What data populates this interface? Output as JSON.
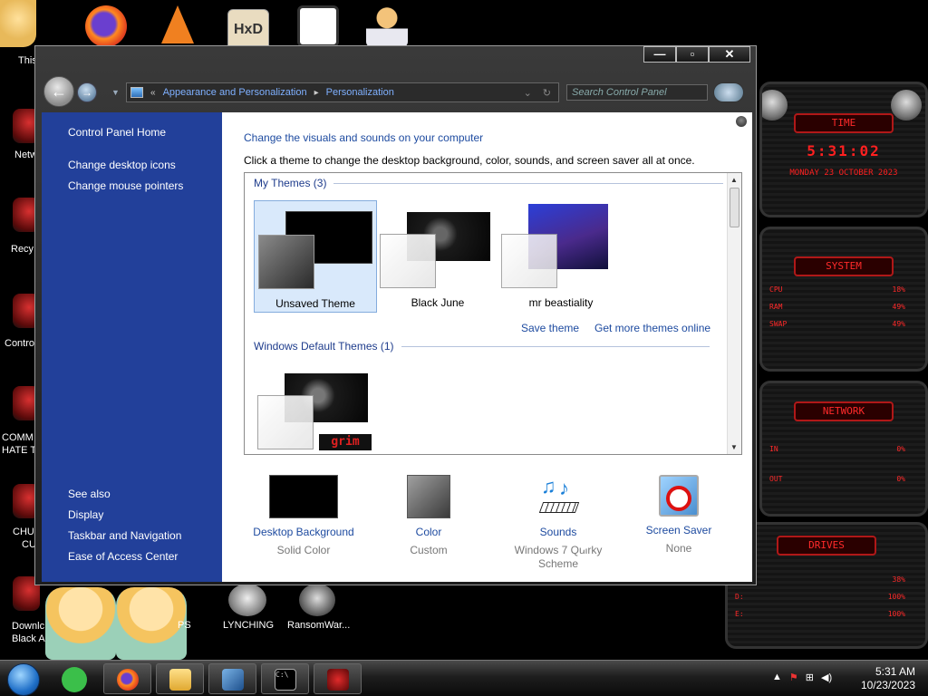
{
  "desktop": {
    "icons": [
      {
        "label": "",
        "color": "#e56020"
      },
      {
        "label": "",
        "color": "#f08020"
      },
      {
        "label": "",
        "color": "#d8c79a"
      },
      {
        "label": "",
        "color": "#44aa55"
      },
      {
        "label": "",
        "color": "#f3c37a"
      }
    ],
    "left_labels": [
      "This",
      "Netw",
      "Recy",
      "Contro",
      "COMM",
      "HATE T",
      "CHU",
      "CU",
      "Downlc",
      "Black Al..."
    ],
    "bottom_icons": [
      {
        "label": "PS"
      },
      {
        "label": "LYNCHING"
      },
      {
        "label": "RansomWar..."
      }
    ]
  },
  "gadget": {
    "time": {
      "title": "TIME",
      "value": "5:31:02",
      "date": "MONDAY 23 OCTOBER 2023"
    },
    "system": {
      "title": "SYSTEM",
      "rows": [
        [
          "CPU",
          "18%"
        ],
        [
          "RAM",
          "49%"
        ],
        [
          "SWAP",
          "49%"
        ]
      ]
    },
    "network": {
      "title": "NETWORK",
      "rows": [
        [
          "IN",
          "0%"
        ],
        [
          "OUT",
          "0%"
        ]
      ]
    },
    "drives": {
      "title": "DRIVES",
      "rows": [
        [
          "C:",
          "38%"
        ],
        [
          "D:",
          "100%"
        ],
        [
          "E:",
          "100%"
        ]
      ]
    }
  },
  "window": {
    "caption": {
      "minimize": "—",
      "maximize": "▫",
      "close": "✕"
    },
    "nav": {
      "back": "←",
      "forward": "→",
      "recent": "▼"
    },
    "address": {
      "root_chevron": "«",
      "crumb1": "Appearance and Personalization",
      "sep": "▸",
      "crumb2": "Personalization",
      "dropdown": "⌄",
      "refresh": "↻"
    },
    "search_placeholder": "Search Control Panel",
    "sidebar": {
      "home": "Control Panel Home",
      "links": [
        "Change desktop icons",
        "Change mouse pointers"
      ],
      "see_also": "See also",
      "see_also_links": [
        "Display",
        "Taskbar and Navigation",
        "Ease of Access Center"
      ]
    },
    "content": {
      "title": "Change the visuals and sounds on your computer",
      "subtitle": "Click a theme to change the desktop background, color, sounds, and screen saver all at once.",
      "my_themes": "My Themes (3)",
      "themes": [
        {
          "name": "Unsaved Theme",
          "bg": "#000000",
          "selected": true
        },
        {
          "name": "Black June",
          "bg": "#1a1a1a",
          "selected": false
        },
        {
          "name": "mr beastiality",
          "bg": "#2a3a8a",
          "selected": false
        }
      ],
      "save_theme": "Save theme",
      "get_more": "Get more themes online",
      "default_themes": "Windows Default Themes (1)",
      "default_theme_badge": "grim"
    },
    "bottom": [
      {
        "name": "Desktop Background",
        "value": "Solid Color"
      },
      {
        "name": "Color",
        "value": "Custom"
      },
      {
        "name": "Sounds",
        "value": "Windows 7 Quirky Scheme"
      },
      {
        "name": "Screen Saver",
        "value": "None"
      }
    ]
  },
  "taskbar": {
    "buttons": [
      "firefox",
      "file-explorer",
      "virtualbox",
      "command-prompt",
      "gadget-app"
    ],
    "clock_time": "5:31 AM",
    "clock_date": "10/23/2023"
  }
}
